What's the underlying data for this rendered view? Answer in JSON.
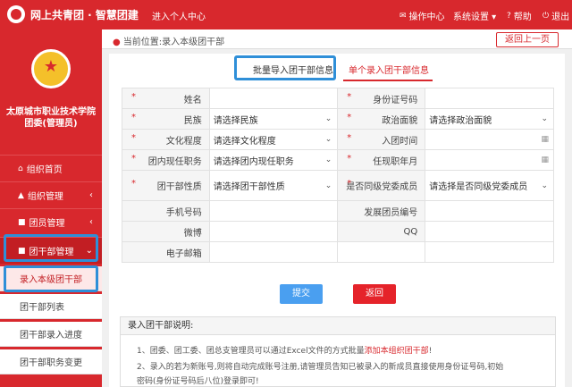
{
  "header": {
    "brand": "网上共青团 · 智慧团建",
    "enter_center": "进入个人中心",
    "nav": [
      {
        "label": "操作中心",
        "icon": "mail-icon"
      },
      {
        "label": "系统设置 ▾",
        "icon": ""
      },
      {
        "label": "帮助",
        "icon": "help-icon"
      },
      {
        "label": "退出",
        "icon": "power-icon"
      }
    ]
  },
  "sidebar": {
    "org_name": "太原城市职业技术学院团委(管理员)",
    "items": [
      {
        "label": "组织首页",
        "icon": "home-icon"
      },
      {
        "label": "组织管理",
        "icon": "org-icon"
      },
      {
        "label": "团员管理",
        "icon": "member-icon"
      },
      {
        "label": "团干部管理",
        "icon": "cadre-icon"
      }
    ],
    "sub_items": [
      "录入本级团干部",
      "团干部列表",
      "团干部录入进度",
      "团干部职务变更"
    ]
  },
  "breadcrumb": "当前位置:录入本级团干部",
  "back_button": "返回上一页",
  "tabs": [
    "批量导入团干部信息",
    "单个录入团干部信息"
  ],
  "form": {
    "name": "姓名",
    "id_number": "身份证号码",
    "ethnicity": "民族",
    "ethnicity_value": "请选择民族",
    "political": "政治面貌",
    "political_value": "请选择政治面貌",
    "education": "文化程度",
    "education_value": "请选择文化程度",
    "join_time": "入团时间",
    "position": "团内现任职务",
    "position_value": "请选择团内现任职务",
    "tenure": "任现职年月",
    "cadre_type": "团干部性质",
    "cadre_type_value": "请选择团干部性质",
    "party_member": "是否同级党委成员",
    "party_member_value": "请选择是否同级党委成员",
    "phone": "手机号码",
    "member_no": "发展团员编号",
    "weibo": "微博",
    "qq": "QQ",
    "email": "电子邮箱"
  },
  "buttons": {
    "submit": "提交",
    "return": "返回"
  },
  "notes": {
    "title": "录入团干部说明:",
    "line1": "1、团委、团工委、团总支管理员可以通过Excel文件的方式批量",
    "line1_em": "添加本组织团干部",
    "line1_end": "!",
    "line2": "2、录入的若为新账号,则将自动完成账号注册,请管理员告知已被录入的新成员直接使用身份证号码,初始",
    "line3": "密码(身份证号码后八位)登录即可!"
  }
}
